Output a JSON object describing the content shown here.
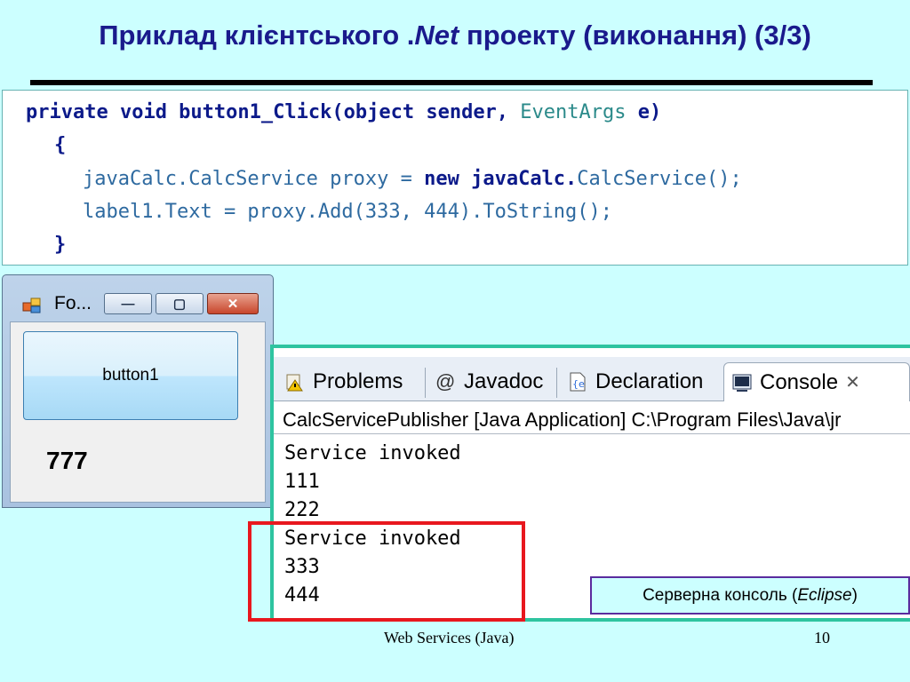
{
  "slide": {
    "title_part1": "Приклад клієнтського .",
    "title_italic": "Net",
    "title_part2": " проекту (виконання)  (3/3)"
  },
  "code": {
    "line1_kw": "private void button1_Click(object sender, ",
    "line1_type": "EventArgs",
    "line1_end": " e)",
    "line2": "{",
    "line3_a": "javaCalc.CalcService proxy = ",
    "line3_kw": "new javaCalc.",
    "line3_b": "CalcService();",
    "line4": "label1.Text = proxy.Add(333, 444).ToString();",
    "line5": "}"
  },
  "winform": {
    "title": "Fo...",
    "button_label": "button1",
    "label_value": "777",
    "icon": "app-window-icon"
  },
  "eclipse": {
    "tabs": [
      {
        "label": "Problems",
        "icon": "problems-icon"
      },
      {
        "label": "Javadoc",
        "icon": "at-sign-icon"
      },
      {
        "label": "Declaration",
        "icon": "declaration-icon"
      },
      {
        "label": "Console",
        "icon": "console-icon"
      }
    ],
    "console_header": "CalcServicePublisher [Java Application] C:\\Program Files\\Java\\jr",
    "output": [
      "Service invoked",
      "111",
      "222",
      "Service invoked",
      "333",
      "444"
    ]
  },
  "note": {
    "text_before": "Серверна консоль (",
    "text_italic": "Eclipse",
    "text_after": " )"
  },
  "footer": {
    "center": "Web Services (Java)",
    "page": "10"
  },
  "colors": {
    "background": "#ccffff",
    "title": "#1a1a8c",
    "highlight": "#e8171e",
    "frame": "#2ec4a0"
  }
}
